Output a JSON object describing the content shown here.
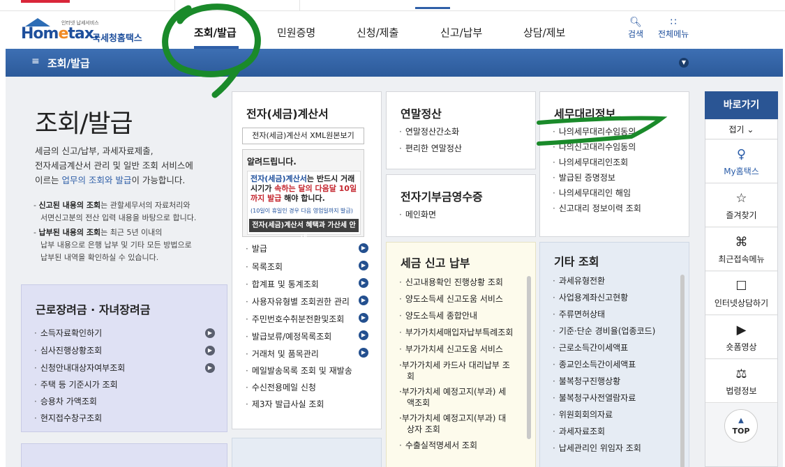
{
  "logo": {
    "small": "인터넷 납세서비스",
    "brand_a": "Hom",
    "brand_e": "e",
    "brand_b": "tax.",
    "ko": "국세청홈택스"
  },
  "gnb": [
    "조회/발급",
    "민원증명",
    "신청/제출",
    "신고/납부",
    "상담/제보"
  ],
  "util": {
    "search": "검색",
    "menu": "전체메뉴"
  },
  "navbar": {
    "title": "조회/발급"
  },
  "intro": {
    "title": "조회/발급",
    "desc_1": "세금의 신고/납부, 과세자료제출,",
    "desc_2": "전자세금계산서 관리 및 일반 조회 서비스에",
    "desc_3a": "이르는 ",
    "desc_3b": "업무의 조회와 발급",
    "desc_3c": "이 가능합니다.",
    "note1_b": "신고된 내용의 조회",
    "note1_a": "- ",
    "note1_c": "는 관할세무서의 자료처리와",
    "note1_d": "서면신고분의 전산 입력 내용을 바탕으로 합니다.",
    "note2_a": "- ",
    "note2_b": "납부된 내용의 조회",
    "note2_c": "는 최근 5년 이내의",
    "note2_d": "납부 내용으로 은행 납부 및 기타 모든 방법으로",
    "note2_e": "납부된 내역을 확인하실 수 있습니다."
  },
  "box_worker": {
    "title": "근로장려금 · 자녀장려금",
    "items": [
      "소득자료확인하기",
      "심사진행상황조회",
      "신청안내대상자여부조회",
      "주택 등 기준시가 조회",
      "승용차 가액조회",
      "현지접수창구조회"
    ]
  },
  "box_einvoice": {
    "title": "전자(세금)계산서",
    "xml_button": "전자(세금)계산서 XML원본보기",
    "notice_title": "알려드립니다.",
    "notice_t1a": "전자(세금)계산서",
    "notice_t1b": "는 반드시 거래시기가 ",
    "notice_t1c": "속하는 달의 다음달 10일까지 발급",
    "notice_t1d": " 해야 합니다.",
    "notice_t2": "(10일이 휴일인 경우 다음 영업일까지 발급)",
    "notice_dark": "전자(세금)계산서 혜택과 가산세 안내",
    "items": [
      "발급",
      "목록조회",
      "합계표 및 통계조회",
      "사용자유형별 조회권한 관리",
      "주민번호수취분전환및조회",
      "발급보류/예정목록조회",
      "거래처 및 품목관리",
      "메일발송목록 조회 및 재발송",
      "수신전용메일 신청",
      "제3자 발급사실 조회"
    ]
  },
  "box_yearend": {
    "title": "연말정산",
    "items": [
      "연말정산간소화",
      "편리한 연말정산"
    ]
  },
  "box_donation": {
    "title": "전자기부금영수증",
    "items": [
      "메인화면"
    ]
  },
  "box_agent": {
    "title": "세무대리정보",
    "items": [
      "나의세무대리수임동의",
      "나의신고대리수임동의",
      "나의세무대리인조회",
      "발급된 증명정보",
      "나의세무대리인 해임",
      "신고대리 정보이력 조회"
    ]
  },
  "box_tax": {
    "title": "세금 신고 납부",
    "items": [
      "신고내용확인 진행상황 조회",
      "양도소득세 신고도움 서비스",
      "양도소득세 종합안내",
      "부가가치세매입자납부특례조회",
      "부가가치세 신고도움 서비스"
    ],
    "wrap_items": [
      {
        "l1": "부가가치세 카드사 대리납부 조",
        "l2": "회"
      },
      {
        "l1": "부가가치세 예정고지(부과) 세",
        "l2": "액조회"
      },
      {
        "l1": "부가가치세 예정고지(부과) 대",
        "l2": "상자 조회"
      }
    ],
    "last_item": "수출실적명세서 조회"
  },
  "box_etc": {
    "title": "기타 조회",
    "items": [
      "과세유형전환",
      "사업용계좌신고현황",
      "주류면허상태",
      "기준·단순 경비율(업종코드)",
      "근로소득간이세액표",
      "종교인소득간이세액표",
      "불복청구진행상황",
      "불복청구사전열람자료",
      "위원회회의자료",
      "과세자료조회",
      "납세관리인 위임자 조회"
    ]
  },
  "quick": {
    "head": "바로가기",
    "fold": "접기",
    "items": [
      "My홈택스",
      "즐겨찾기",
      "최근접속메뉴",
      "인터넷상담하기",
      "숏폼영상",
      "법령정보"
    ],
    "top": "TOP"
  },
  "colors": {
    "primary": "#2a5594",
    "annotation": "#1a8a2a"
  }
}
